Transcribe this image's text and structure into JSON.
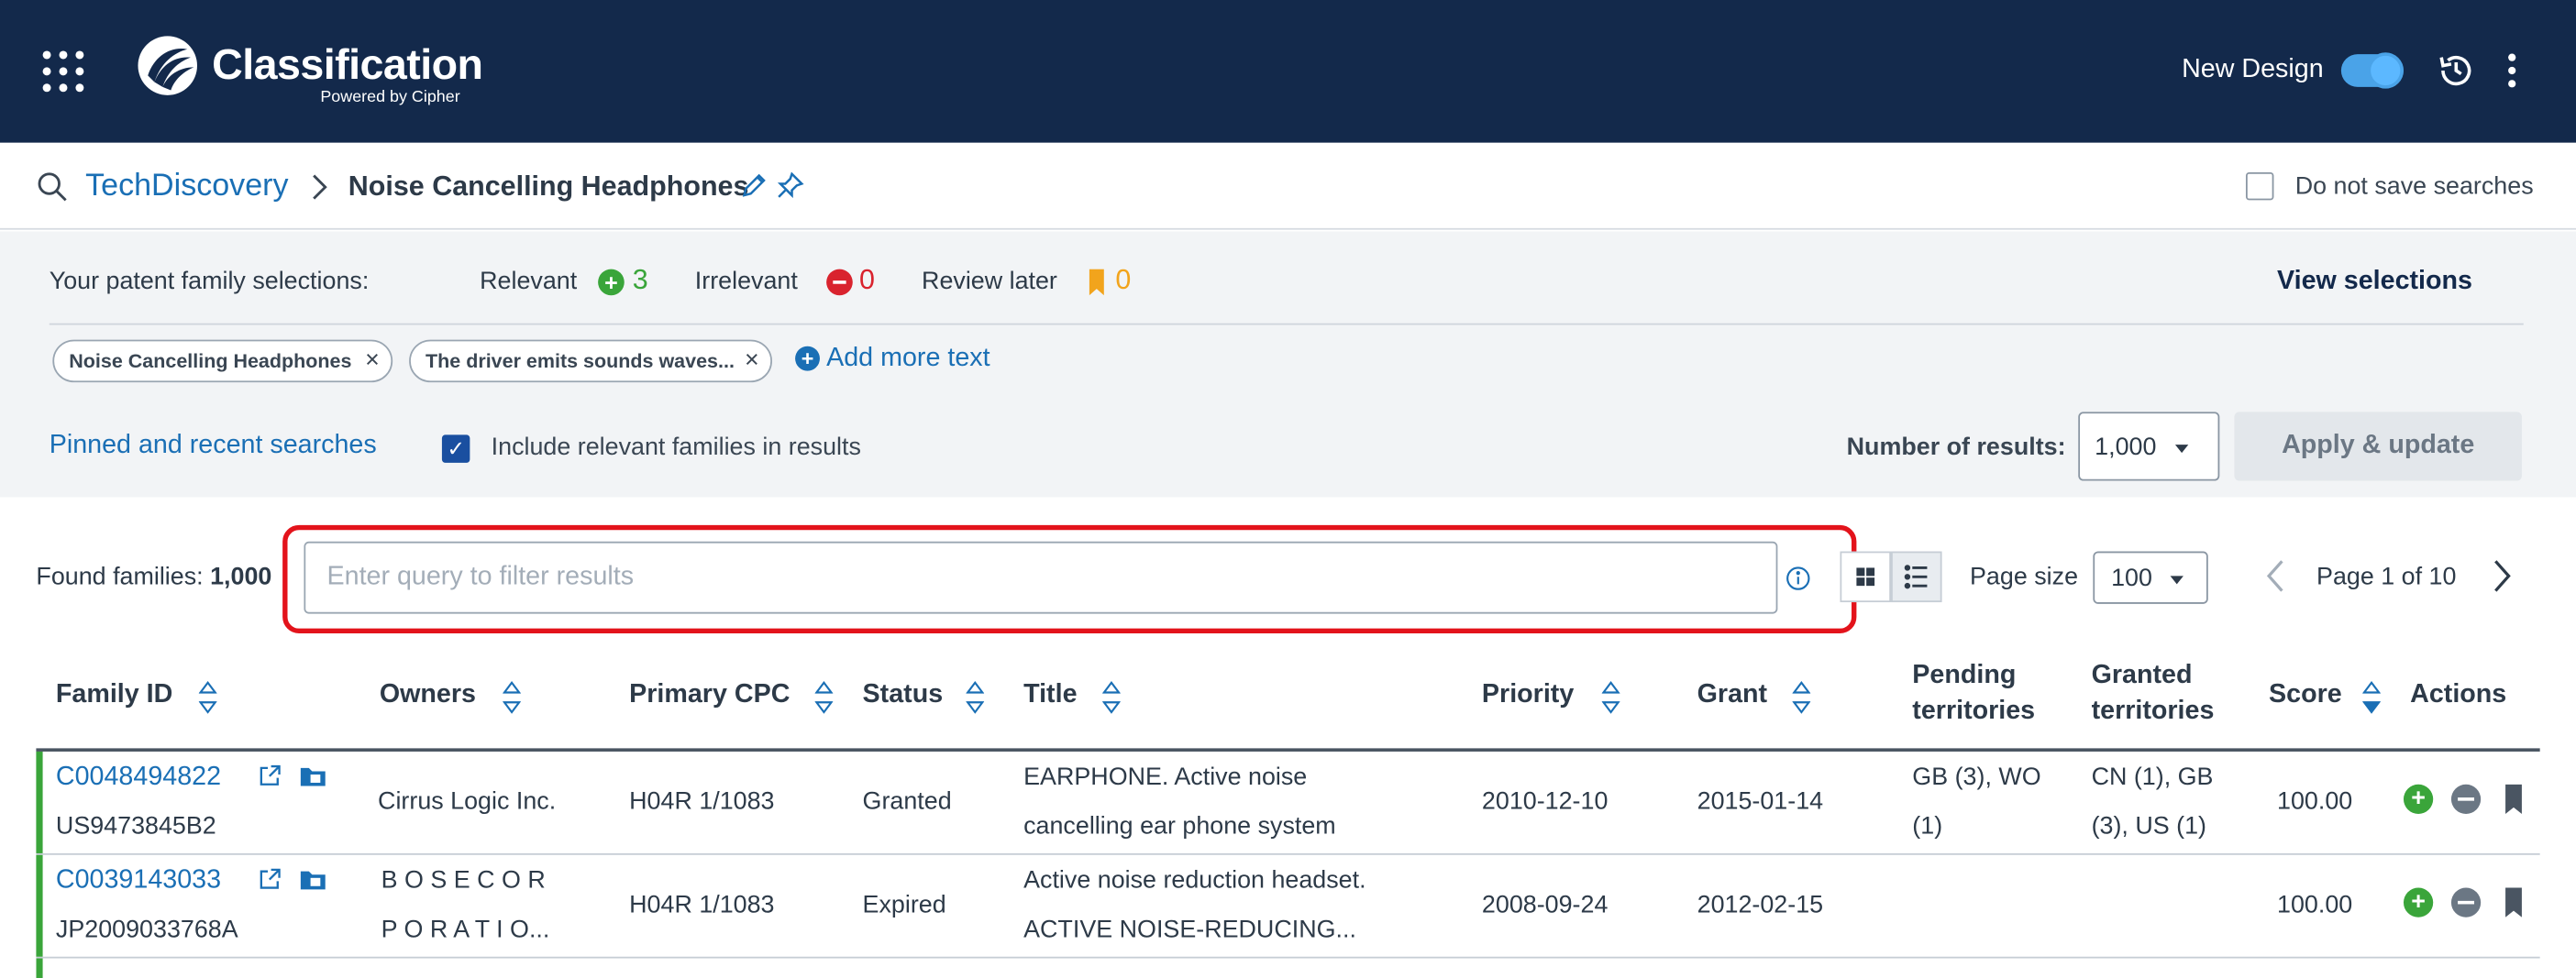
{
  "header": {
    "brand": "Classification",
    "brand_sub": "Powered by Cipher",
    "new_design_label": "New Design",
    "new_design_on": true
  },
  "breadcrumb": {
    "root": "TechDiscovery",
    "current": "Noise Cancelling Headphones",
    "no_save_label": "Do not save searches"
  },
  "selections": {
    "label": "Your patent family selections:",
    "relevant_label": "Relevant",
    "relevant_count": "3",
    "irrelevant_label": "Irrelevant",
    "irrelevant_count": "0",
    "review_later_label": "Review later",
    "review_later_count": "0",
    "view_selections": "View selections"
  },
  "chips": [
    {
      "label": "Noise Cancelling Headphones"
    },
    {
      "label": "The driver emits sounds waves..."
    }
  ],
  "add_more_text": "Add more text",
  "pinned_label": "Pinned and recent searches",
  "include_relevant_label": "Include relevant families in results",
  "number_of_results_label": "Number of results:",
  "number_of_results_value": "1,000",
  "apply_label": "Apply & update",
  "results": {
    "found_label": "Found families:",
    "found_count": "1,000",
    "filter_placeholder": "Enter query to filter results",
    "page_size_label": "Page size",
    "page_size_value": "100",
    "page_label": "Page 1 of 10"
  },
  "table": {
    "headers": {
      "family_id": "Family ID",
      "owners": "Owners",
      "primary_cpc": "Primary CPC",
      "status": "Status",
      "title": "Title",
      "priority": "Priority",
      "grant": "Grant",
      "pending_1": "Pending",
      "pending_2": "territories",
      "granted_1": "Granted",
      "granted_2": "territories",
      "score": "Score",
      "actions": "Actions"
    },
    "rows": [
      {
        "family_id": "C0048494822",
        "pub": "US9473845B2",
        "owner_1": "Cirrus Logic Inc.",
        "owner_2": "",
        "cpc": "H04R 1/1083",
        "status": "Granted",
        "title_1": "EARPHONE. Active noise",
        "title_2": "cancelling ear phone system",
        "priority": "2010-12-10",
        "grant": "2015-01-14",
        "pending_1": "GB (3), WO",
        "pending_2": "(1)",
        "granted_1": "CN (1), GB",
        "granted_2": "(3), US (1)",
        "score": "100.00"
      },
      {
        "family_id": "C0039143033",
        "pub": "JP2009033768A",
        "owner_1": "B O S E C O R",
        "owner_2": "P O R A T I O...",
        "cpc": "H04R 1/1083",
        "status": "Expired",
        "title_1": "Active noise reduction headset.",
        "title_2": "ACTIVE NOISE-REDUCING...",
        "priority": "2008-09-24",
        "grant": "2012-02-15",
        "pending_1": "",
        "pending_2": "",
        "granted_1": "",
        "granted_2": "",
        "score": "100.00"
      }
    ]
  },
  "colors": {
    "topbar": "#13294b",
    "link": "#1a6fb5",
    "relevant": "#3aa53a",
    "irrelevant": "#d9232e",
    "review_later": "#f2a41c",
    "highlight": "#e3131b"
  }
}
